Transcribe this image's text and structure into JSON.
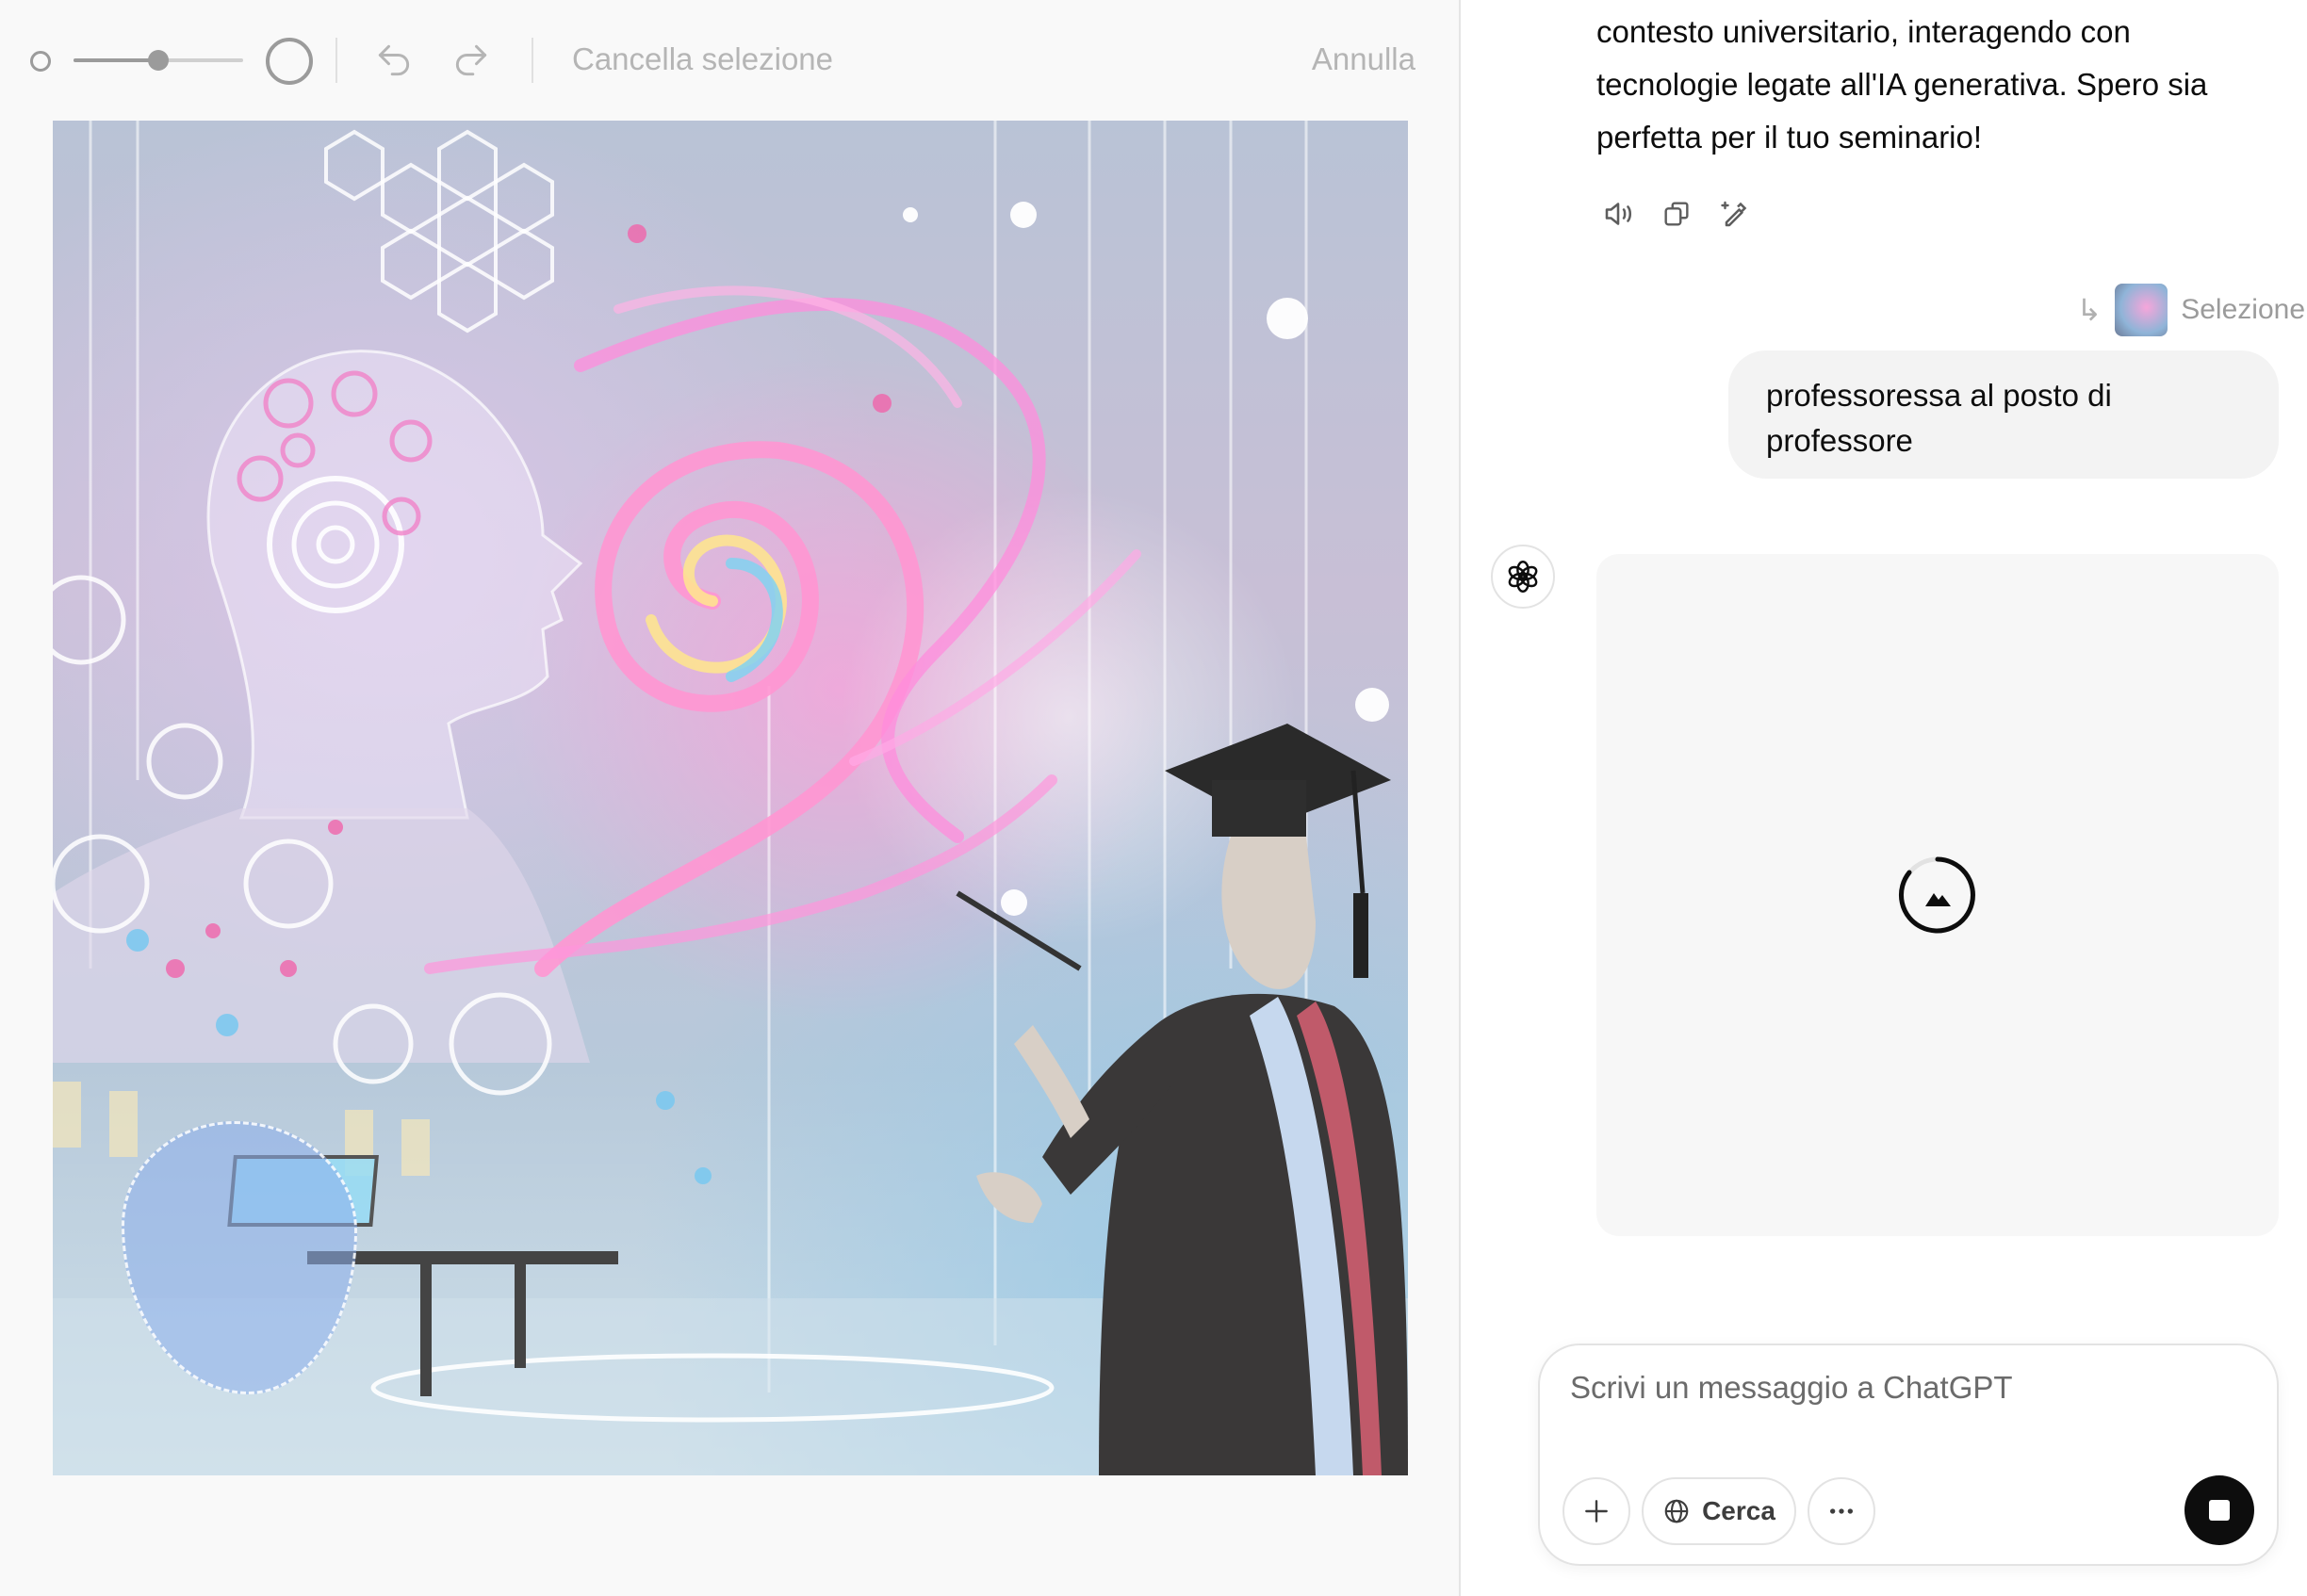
{
  "toolbar": {
    "brush_size_level": 0.5,
    "clear_selection_label": "Cancella selezione",
    "cancel_label": "Annulla"
  },
  "chat": {
    "assistant_text_lines": [
      "contesto universitario, interagendo con",
      "tecnologie legate all'IA generativa. Spero sia",
      "perfetta per il tuo seminario!"
    ],
    "message_actions": [
      "read-aloud-icon",
      "copy-icon",
      "edit-image-icon"
    ],
    "selection_ref_label": "Selezione",
    "user_message": "professoressa al posto di professore",
    "composer": {
      "placeholder": "Scrivi un messaggio a ChatGPT",
      "search_label": "Cerca"
    }
  }
}
